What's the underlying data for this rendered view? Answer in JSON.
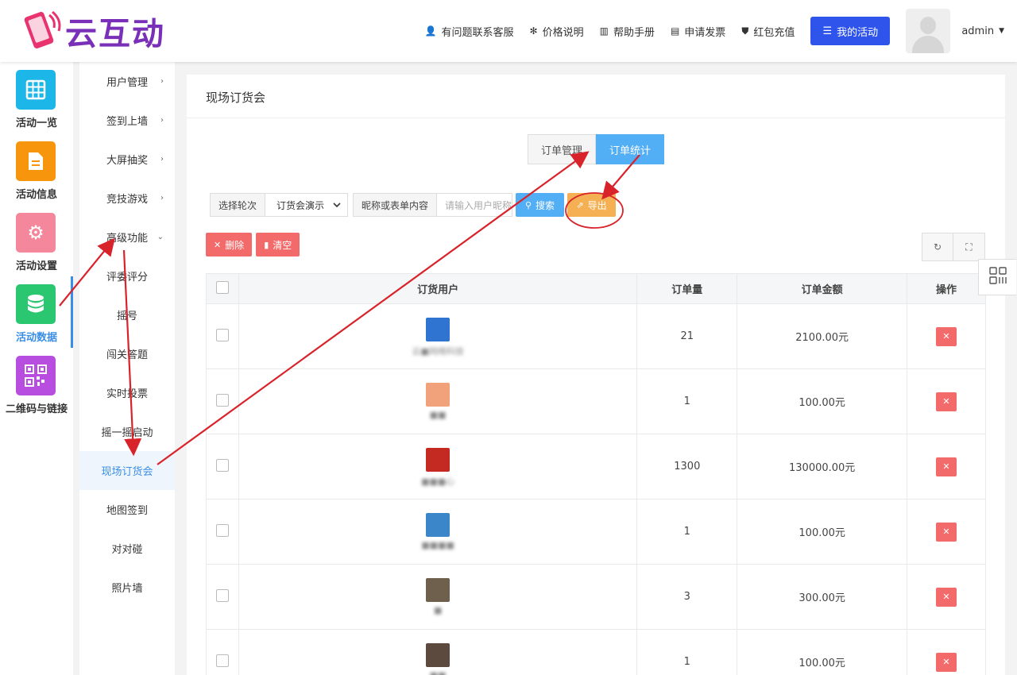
{
  "brand": {
    "name": "云互动"
  },
  "topnav": {
    "items": [
      {
        "label": "有问题联系客服",
        "icon": "user-plus-icon"
      },
      {
        "label": "价格说明",
        "icon": "gear-badge-icon"
      },
      {
        "label": "帮助手册",
        "icon": "book-icon"
      },
      {
        "label": "申请发票",
        "icon": "printer-icon"
      },
      {
        "label": "红包充值",
        "icon": "shield-check-icon"
      }
    ],
    "my_activity": "我的活动",
    "user": "admin"
  },
  "rail": {
    "items": [
      {
        "label": "活动一览",
        "color": "#1cb6e8",
        "icon": "grid-icon"
      },
      {
        "label": "活动信息",
        "color": "#f7960c",
        "icon": "document-icon"
      },
      {
        "label": "活动设置",
        "color": "#f4879c",
        "icon": "gear-icon"
      },
      {
        "label": "活动数据",
        "color": "#2bc670",
        "icon": "database-icon",
        "active": true
      },
      {
        "label": "二维码与链接",
        "color": "#b84ee0",
        "icon": "qrcode-icon"
      }
    ]
  },
  "submenu": {
    "items": [
      {
        "label": "用户管理",
        "arrow": "›"
      },
      {
        "label": "签到上墙",
        "arrow": "›"
      },
      {
        "label": "大屏抽奖",
        "arrow": "›"
      },
      {
        "label": "竞技游戏",
        "arrow": "›"
      },
      {
        "label": "高级功能",
        "arrow": "⌄"
      },
      {
        "label": "评委评分"
      },
      {
        "label": "摇号"
      },
      {
        "label": "闯关答题"
      },
      {
        "label": "实时投票"
      },
      {
        "label": "摇一摇启动"
      },
      {
        "label": "现场订货会",
        "active": true
      },
      {
        "label": "地图签到"
      },
      {
        "label": "对对碰"
      },
      {
        "label": "照片墙"
      }
    ]
  },
  "panel": {
    "title": "现场订货会",
    "tabs": {
      "manage": "订单管理",
      "stats": "订单统计"
    },
    "filter": {
      "round_label": "选择轮次",
      "round_value": "订货会演示",
      "keyword_label": "昵称或表单内容",
      "keyword_placeholder": "请输入用户昵称",
      "search": "搜索",
      "export": "导出"
    },
    "actions": {
      "delete": "删除",
      "clear": "清空"
    }
  },
  "table": {
    "headers": {
      "user": "订货用户",
      "qty": "订单量",
      "amount": "订单金额",
      "op": "操作"
    },
    "rows": [
      {
        "name": "云■网络科技",
        "qty": "21",
        "amount": "2100.00元",
        "avatar_color": "#2f74d0"
      },
      {
        "name": "■■",
        "qty": "1",
        "amount": "100.00元",
        "avatar_color": "#f2a27a"
      },
      {
        "name": "■■■心",
        "qty": "1300",
        "amount": "130000.00元",
        "avatar_color": "#c42a22"
      },
      {
        "name": "■■■■",
        "qty": "1",
        "amount": "100.00元",
        "avatar_color": "#3a86c8"
      },
      {
        "name": "■",
        "qty": "3",
        "amount": "300.00元",
        "avatar_color": "#6f5f4d"
      },
      {
        "name": "■■",
        "qty": "1",
        "amount": "100.00元",
        "avatar_color": "#5c4a3e"
      }
    ]
  }
}
